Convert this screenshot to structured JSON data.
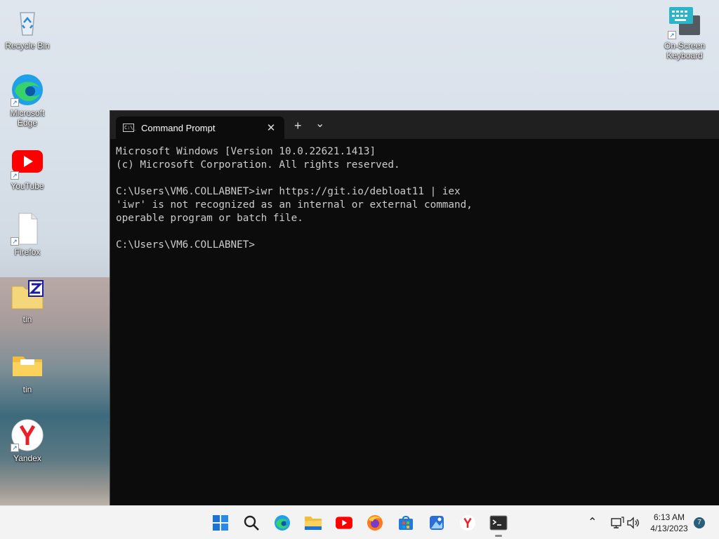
{
  "desktop": {
    "icons": [
      {
        "label": "Recycle Bin"
      },
      {
        "label": "Microsoft Edge"
      },
      {
        "label": "YouTube"
      },
      {
        "label": "Firefox"
      },
      {
        "label": "tin"
      },
      {
        "label": "tin"
      },
      {
        "label": "Yandex"
      },
      {
        "label": "On-Screen Keyboard"
      }
    ]
  },
  "window": {
    "tab_title": "Command Prompt",
    "close_glyph": "✕",
    "new_tab_glyph": "+",
    "dropdown_glyph": "⌄",
    "lines": [
      "Microsoft Windows [Version 10.0.22621.1413]",
      "(c) Microsoft Corporation. All rights reserved.",
      "",
      "C:\\Users\\VM6.COLLABNET>iwr https://git.io/debloat11 | iex",
      "'iwr' is not recognized as an internal or external command,",
      "operable program or batch file.",
      "",
      "C:\\Users\\VM6.COLLABNET>"
    ]
  },
  "taskbar": {
    "time": "6:13 AM",
    "date": "4/13/2023",
    "notification_count": "7"
  },
  "colors": {
    "terminal_bg": "#0c0c0c",
    "terminal_text": "#cccccc",
    "taskbar_bg": "#f3f3f3"
  }
}
